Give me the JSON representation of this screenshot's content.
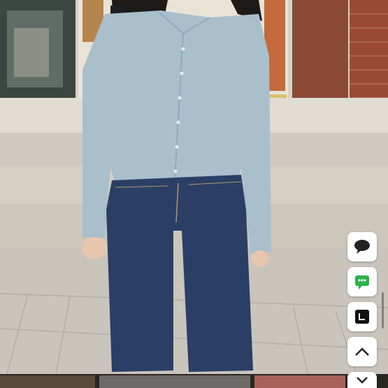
{
  "photo": {
    "subject": "product-photo",
    "accent_colors": {
      "cardigan": "#a9bfcc",
      "jeans": "#2b3f66",
      "brick": "#8a4a36",
      "pavement": "#c8c4bd"
    }
  },
  "floating_buttons": [
    {
      "name": "chat-button",
      "icon": "speech-bubble-icon"
    },
    {
      "name": "talk-button",
      "icon": "green-chat-icon",
      "color": "#2bb34a"
    },
    {
      "name": "line-button",
      "icon": "line-box-icon"
    },
    {
      "name": "scroll-top-button",
      "icon": "chevron-up-icon"
    },
    {
      "name": "scroll-down-button",
      "icon": "chevron-down-icon"
    }
  ],
  "thumbnails": [
    {
      "name": "thumbnail-1"
    },
    {
      "name": "thumbnail-2"
    },
    {
      "name": "thumbnail-3"
    }
  ]
}
